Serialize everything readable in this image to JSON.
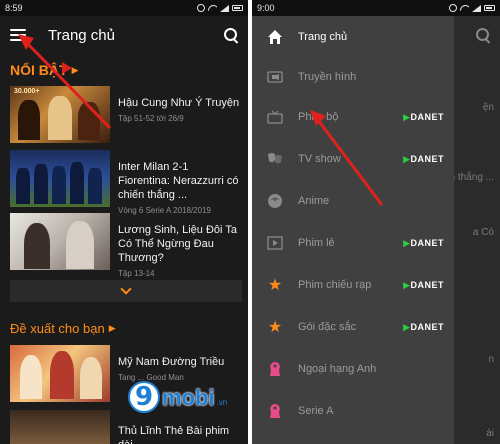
{
  "left_phone": {
    "status": {
      "time": "8:59"
    },
    "header": {
      "title": "Trang chủ"
    },
    "section1": {
      "title": "NỔI BẬT"
    },
    "items": [
      {
        "title": "Hậu Cung Như Ý Truyện",
        "subtitle": "Tập 51-52 tới 26/9"
      },
      {
        "title": "Inter Milan 2-1 Fiorentina: Nerazzurri có chiến thắng ...",
        "subtitle": "Vòng 6 Serie A 2018/2019"
      },
      {
        "title": "Lương Sinh, Liệu Đôi Ta Có Thể Ngừng Đau Thương?",
        "subtitle": "Tập 13-14"
      }
    ],
    "section2": {
      "title": "Đề xuất cho bạn"
    },
    "items2": [
      {
        "title": "Mỹ Nam Đường Triều",
        "subtitle": "Tang ... Good Man"
      },
      {
        "title": "Thủ Lĩnh Thẻ Bài phim dài",
        "subtitle": ""
      }
    ],
    "thumb_text": {
      "poster1": "30.000+"
    },
    "watermark": {
      "nine": "9",
      "word": "mobi",
      "tld": ".vn"
    }
  },
  "right_phone": {
    "status": {
      "time": "9:00"
    },
    "menu": [
      {
        "label": "Trang chủ",
        "icon": "home-icon",
        "badge": ""
      },
      {
        "label": "Truyền hình",
        "icon": "tv-camera-icon",
        "badge": ""
      },
      {
        "label": "Phim bộ",
        "icon": "tv-icon",
        "badge": "DANET"
      },
      {
        "label": "TV show",
        "icon": "masks-icon",
        "badge": "DANET"
      },
      {
        "label": "Anime",
        "icon": "anime-icon",
        "badge": ""
      },
      {
        "label": "Phim lẻ",
        "icon": "film-icon",
        "badge": "DANET"
      },
      {
        "label": "Phim chiếu rạp",
        "icon": "star-icon",
        "badge": "DANET"
      },
      {
        "label": "Gói đặc sắc",
        "icon": "star-icon",
        "badge": "DANET"
      },
      {
        "label": "Ngoại hạng Anh",
        "icon": "premier-league-icon",
        "badge": ""
      },
      {
        "label": "Serie A",
        "icon": "premier-league-icon",
        "badge": ""
      }
    ],
    "ghost_texts": [
      "ện",
      "ó chiến thắng ...",
      "a Có",
      "n",
      "ài"
    ]
  },
  "colors": {
    "accent": "#ff8c1a",
    "drawer_bg": "#404040",
    "app_bg": "#1b1b1b",
    "arrow": "#e0201c",
    "danet_green": "#2ecc40"
  }
}
